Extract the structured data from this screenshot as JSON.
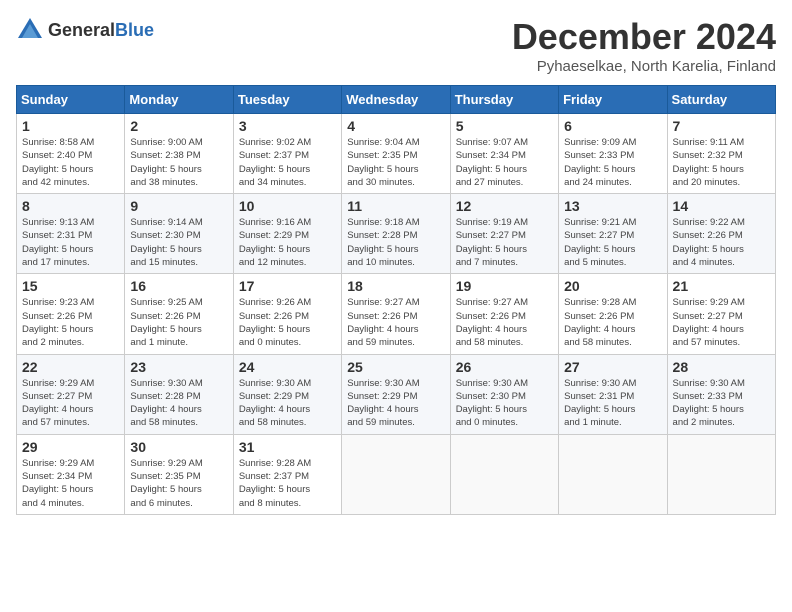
{
  "logo": {
    "general": "General",
    "blue": "Blue"
  },
  "header": {
    "title": "December 2024",
    "subtitle": "Pyhaeselkae, North Karelia, Finland"
  },
  "weekdays": [
    "Sunday",
    "Monday",
    "Tuesday",
    "Wednesday",
    "Thursday",
    "Friday",
    "Saturday"
  ],
  "weeks": [
    [
      {
        "day": "1",
        "info": "Sunrise: 8:58 AM\nSunset: 2:40 PM\nDaylight: 5 hours\nand 42 minutes."
      },
      {
        "day": "2",
        "info": "Sunrise: 9:00 AM\nSunset: 2:38 PM\nDaylight: 5 hours\nand 38 minutes."
      },
      {
        "day": "3",
        "info": "Sunrise: 9:02 AM\nSunset: 2:37 PM\nDaylight: 5 hours\nand 34 minutes."
      },
      {
        "day": "4",
        "info": "Sunrise: 9:04 AM\nSunset: 2:35 PM\nDaylight: 5 hours\nand 30 minutes."
      },
      {
        "day": "5",
        "info": "Sunrise: 9:07 AM\nSunset: 2:34 PM\nDaylight: 5 hours\nand 27 minutes."
      },
      {
        "day": "6",
        "info": "Sunrise: 9:09 AM\nSunset: 2:33 PM\nDaylight: 5 hours\nand 24 minutes."
      },
      {
        "day": "7",
        "info": "Sunrise: 9:11 AM\nSunset: 2:32 PM\nDaylight: 5 hours\nand 20 minutes."
      }
    ],
    [
      {
        "day": "8",
        "info": "Sunrise: 9:13 AM\nSunset: 2:31 PM\nDaylight: 5 hours\nand 17 minutes."
      },
      {
        "day": "9",
        "info": "Sunrise: 9:14 AM\nSunset: 2:30 PM\nDaylight: 5 hours\nand 15 minutes."
      },
      {
        "day": "10",
        "info": "Sunrise: 9:16 AM\nSunset: 2:29 PM\nDaylight: 5 hours\nand 12 minutes."
      },
      {
        "day": "11",
        "info": "Sunrise: 9:18 AM\nSunset: 2:28 PM\nDaylight: 5 hours\nand 10 minutes."
      },
      {
        "day": "12",
        "info": "Sunrise: 9:19 AM\nSunset: 2:27 PM\nDaylight: 5 hours\nand 7 minutes."
      },
      {
        "day": "13",
        "info": "Sunrise: 9:21 AM\nSunset: 2:27 PM\nDaylight: 5 hours\nand 5 minutes."
      },
      {
        "day": "14",
        "info": "Sunrise: 9:22 AM\nSunset: 2:26 PM\nDaylight: 5 hours\nand 4 minutes."
      }
    ],
    [
      {
        "day": "15",
        "info": "Sunrise: 9:23 AM\nSunset: 2:26 PM\nDaylight: 5 hours\nand 2 minutes."
      },
      {
        "day": "16",
        "info": "Sunrise: 9:25 AM\nSunset: 2:26 PM\nDaylight: 5 hours\nand 1 minute."
      },
      {
        "day": "17",
        "info": "Sunrise: 9:26 AM\nSunset: 2:26 PM\nDaylight: 5 hours\nand 0 minutes."
      },
      {
        "day": "18",
        "info": "Sunrise: 9:27 AM\nSunset: 2:26 PM\nDaylight: 4 hours\nand 59 minutes."
      },
      {
        "day": "19",
        "info": "Sunrise: 9:27 AM\nSunset: 2:26 PM\nDaylight: 4 hours\nand 58 minutes."
      },
      {
        "day": "20",
        "info": "Sunrise: 9:28 AM\nSunset: 2:26 PM\nDaylight: 4 hours\nand 58 minutes."
      },
      {
        "day": "21",
        "info": "Sunrise: 9:29 AM\nSunset: 2:27 PM\nDaylight: 4 hours\nand 57 minutes."
      }
    ],
    [
      {
        "day": "22",
        "info": "Sunrise: 9:29 AM\nSunset: 2:27 PM\nDaylight: 4 hours\nand 57 minutes."
      },
      {
        "day": "23",
        "info": "Sunrise: 9:30 AM\nSunset: 2:28 PM\nDaylight: 4 hours\nand 58 minutes."
      },
      {
        "day": "24",
        "info": "Sunrise: 9:30 AM\nSunset: 2:29 PM\nDaylight: 4 hours\nand 58 minutes."
      },
      {
        "day": "25",
        "info": "Sunrise: 9:30 AM\nSunset: 2:29 PM\nDaylight: 4 hours\nand 59 minutes."
      },
      {
        "day": "26",
        "info": "Sunrise: 9:30 AM\nSunset: 2:30 PM\nDaylight: 5 hours\nand 0 minutes."
      },
      {
        "day": "27",
        "info": "Sunrise: 9:30 AM\nSunset: 2:31 PM\nDaylight: 5 hours\nand 1 minute."
      },
      {
        "day": "28",
        "info": "Sunrise: 9:30 AM\nSunset: 2:33 PM\nDaylight: 5 hours\nand 2 minutes."
      }
    ],
    [
      {
        "day": "29",
        "info": "Sunrise: 9:29 AM\nSunset: 2:34 PM\nDaylight: 5 hours\nand 4 minutes."
      },
      {
        "day": "30",
        "info": "Sunrise: 9:29 AM\nSunset: 2:35 PM\nDaylight: 5 hours\nand 6 minutes."
      },
      {
        "day": "31",
        "info": "Sunrise: 9:28 AM\nSunset: 2:37 PM\nDaylight: 5 hours\nand 8 minutes."
      },
      {
        "day": "",
        "info": ""
      },
      {
        "day": "",
        "info": ""
      },
      {
        "day": "",
        "info": ""
      },
      {
        "day": "",
        "info": ""
      }
    ]
  ]
}
